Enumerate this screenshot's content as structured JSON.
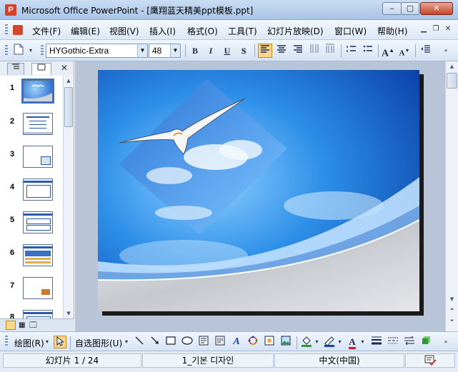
{
  "window": {
    "app_icon": "P",
    "title": "Microsoft Office PowerPoint - [鹰翔蓝天精美ppt模板.ppt]",
    "min_glyph": "‒",
    "max_glyph": "▢",
    "close_glyph": "✕"
  },
  "menu": {
    "items": [
      "文件(F)",
      "编辑(E)",
      "视图(V)",
      "插入(I)",
      "格式(O)",
      "工具(T)",
      "幻灯片放映(D)",
      "窗口(W)",
      "帮助(H)"
    ]
  },
  "toolbar": {
    "font_name": "HYGothic-Extra",
    "font_size": "48",
    "bold": "B",
    "italic": "I",
    "underline": "U",
    "shadow": "S",
    "grow_font": "A",
    "shrink_font": "A"
  },
  "slides_pane": {
    "close_glyph": "✕",
    "thumb_numbers": [
      "1",
      "2",
      "3",
      "4",
      "5",
      "6",
      "7",
      "8"
    ]
  },
  "drawing_toolbar": {
    "draw_label": "绘图(R)",
    "autoshapes_label": "自选图形(U)"
  },
  "status": {
    "slide_info": "幻灯片 1 / 24",
    "design": "1_기본 디자인",
    "language": "中文(中国)"
  },
  "colors": {
    "fill_color": "#2f9b2f",
    "line_color": "#1a3fa8",
    "font_color": "#d41c1c"
  },
  "icons": [
    "office-powerpoint-icon",
    "new-document-icon",
    "align-left-icon",
    "center-icon",
    "align-right-icon",
    "distributed-icon",
    "numbering-icon",
    "bullets-icon",
    "decrease-indent-icon",
    "pointer-icon",
    "line-icon",
    "arrow-icon",
    "rectangle-icon",
    "oval-icon",
    "textbox-icon",
    "vertical-textbox-icon",
    "wordart-icon",
    "diagram-icon",
    "clipart-icon",
    "picture-icon",
    "fill-color-icon",
    "line-color-icon",
    "font-color-icon",
    "line-style-icon",
    "dash-style-icon",
    "arrow-style-icon",
    "3d-style-icon",
    "spell-check-icon"
  ]
}
